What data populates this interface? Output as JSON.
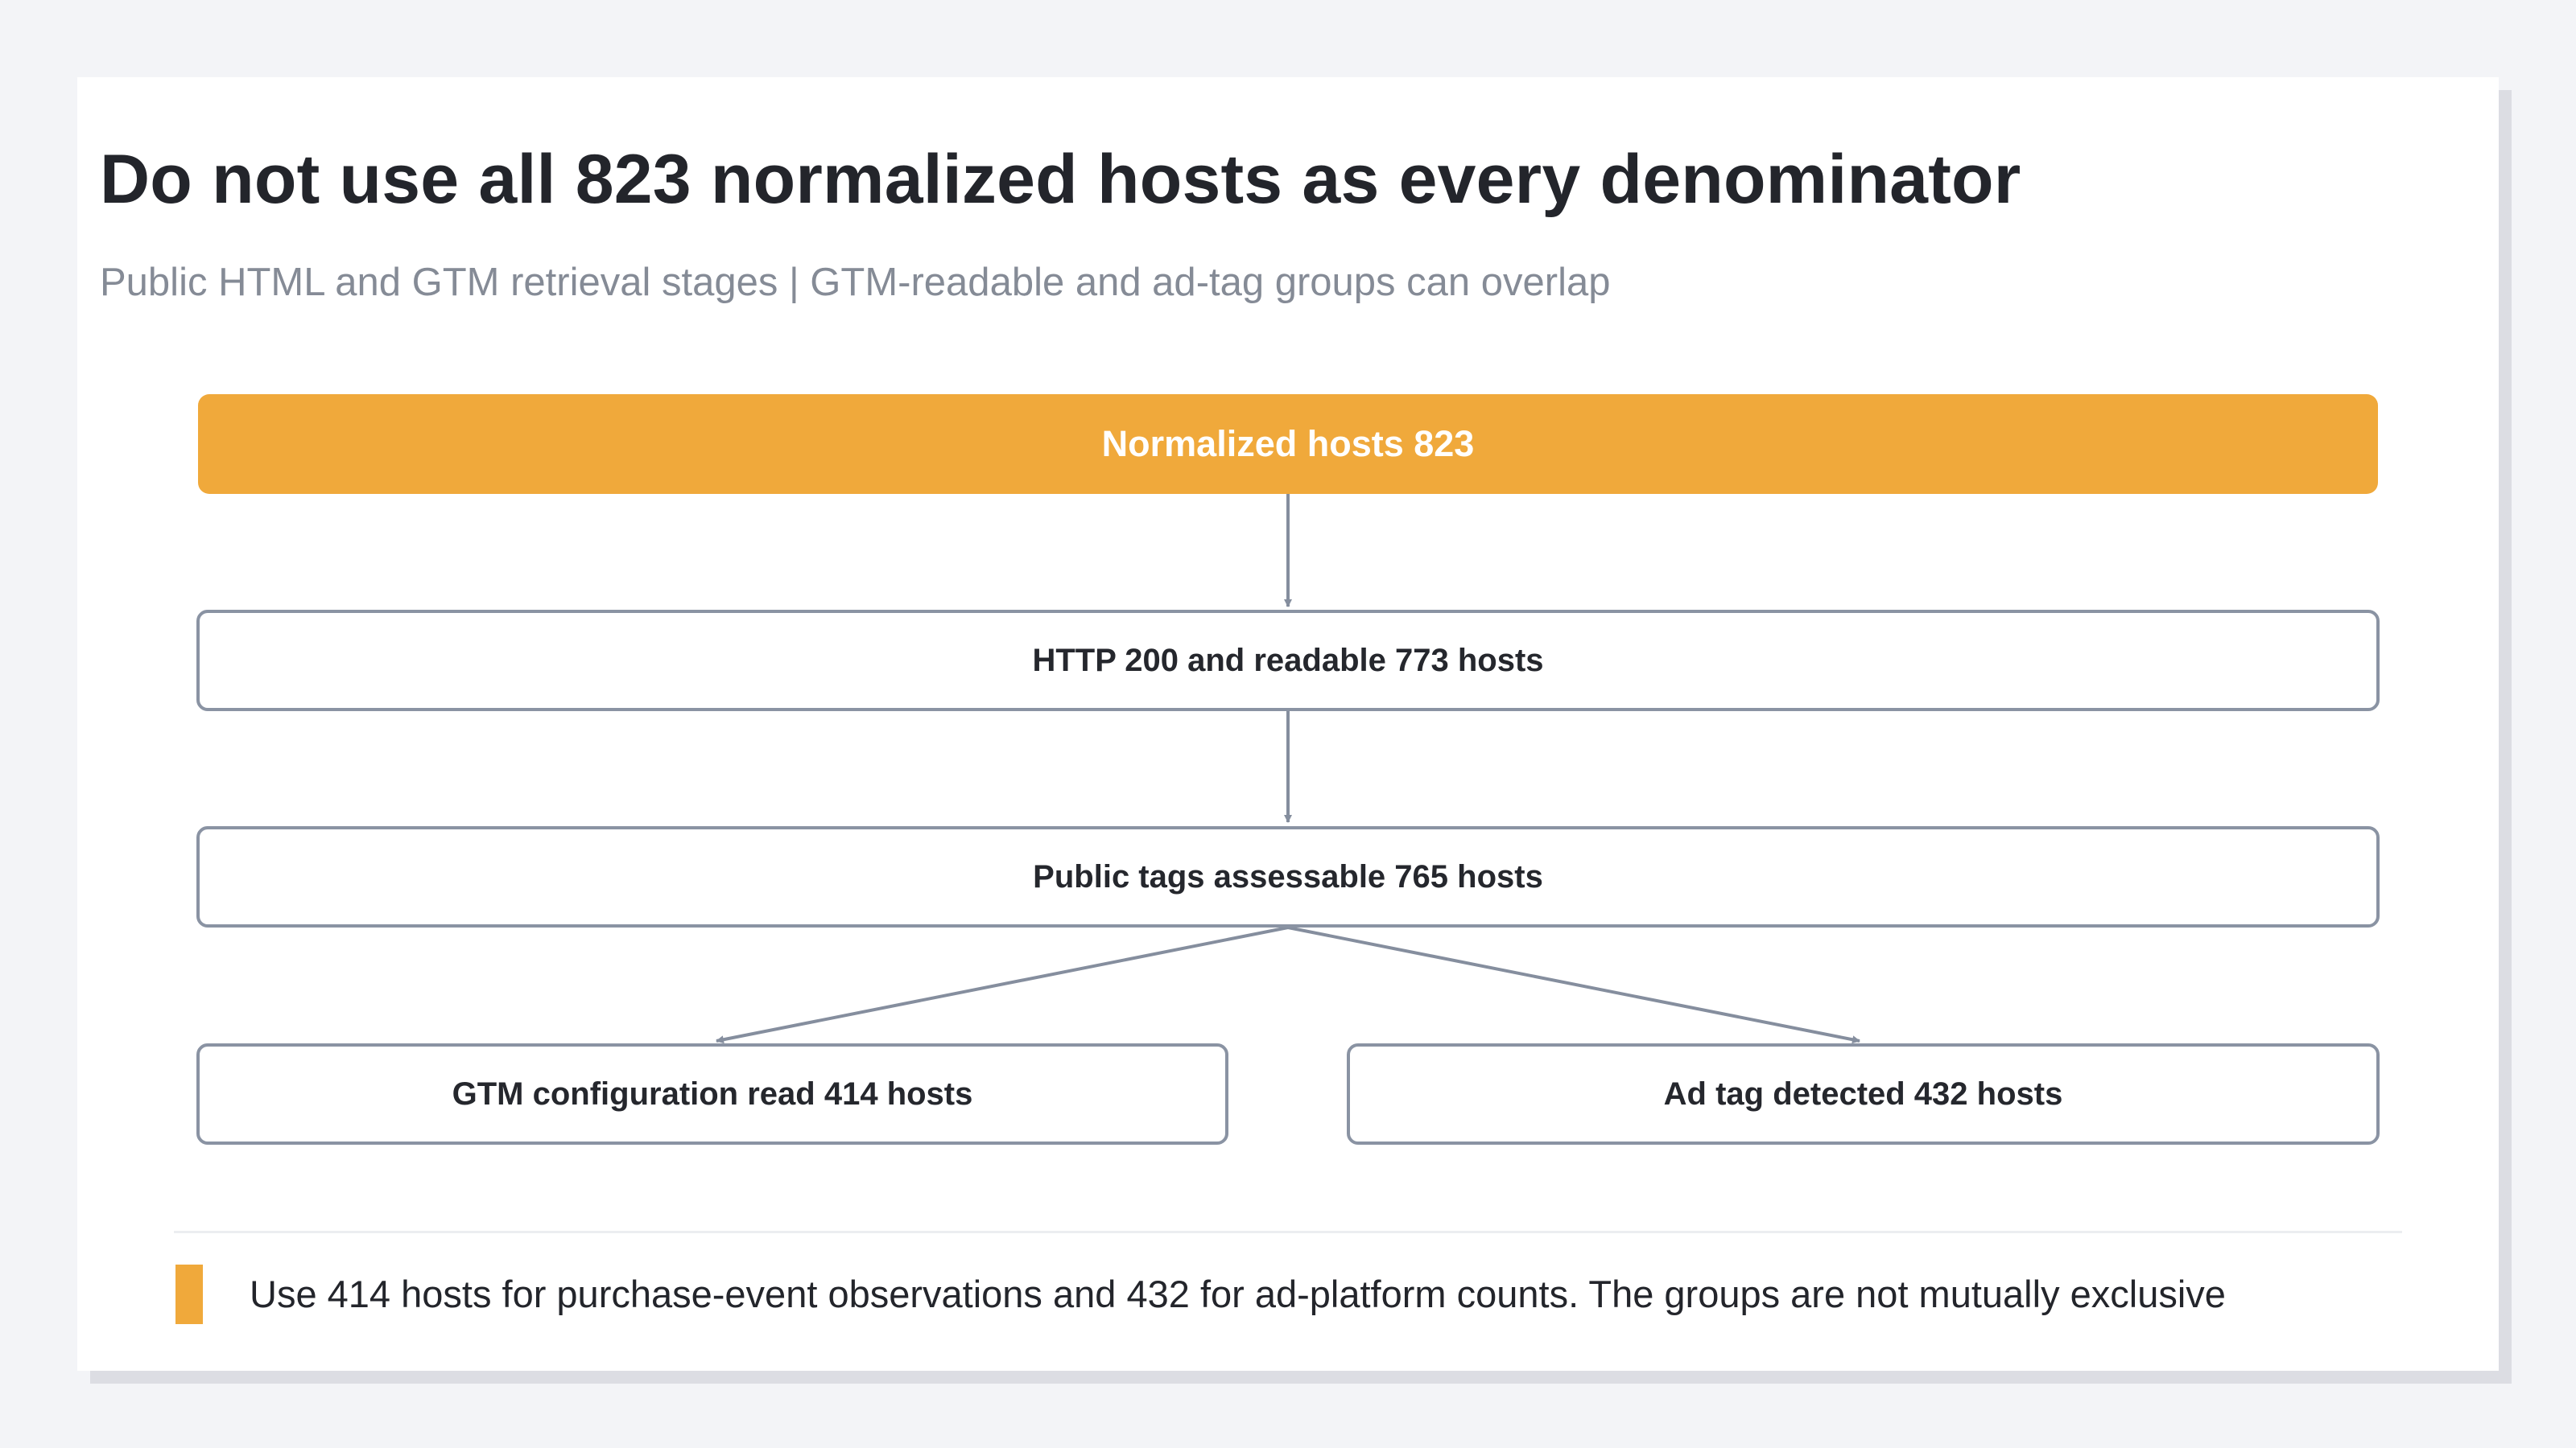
{
  "header": {
    "title": "Do not use all 823 normalized hosts as every denominator",
    "subtitle": "Public HTML and GTM retrieval stages | GTM-readable and ad-tag groups can overlap"
  },
  "diagram": {
    "nodes": [
      {
        "id": "normalized",
        "label": "Normalized hosts 823"
      },
      {
        "id": "readable",
        "label": "HTTP 200 and readable 773 hosts"
      },
      {
        "id": "assessable",
        "label": "Public tags assessable 765 hosts"
      },
      {
        "id": "gtm",
        "label": "GTM configuration read 414 hosts"
      },
      {
        "id": "adtag",
        "label": "Ad tag detected 432 hosts"
      }
    ],
    "edges": [
      {
        "from": "normalized",
        "to": "readable"
      },
      {
        "from": "readable",
        "to": "assessable"
      },
      {
        "from": "assessable",
        "to": "gtm"
      },
      {
        "from": "assessable",
        "to": "adtag"
      }
    ]
  },
  "footer": {
    "note": "Use 414 hosts for purchase-event observations and 432 for ad-platform counts. The groups are not mutually exclusive"
  },
  "colors": {
    "accent": "#f0a93b",
    "border": "#8a93a3",
    "connector": "#858e9e",
    "title": "#23252b",
    "subtitle": "#858b96"
  }
}
